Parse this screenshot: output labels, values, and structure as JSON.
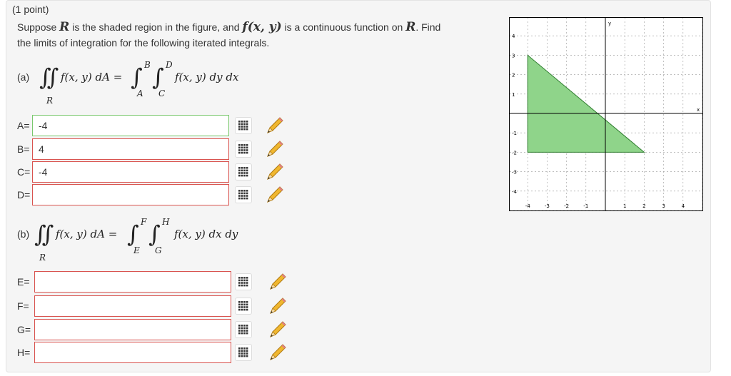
{
  "header": {
    "points": "(1 point)"
  },
  "problem": {
    "t1": "Suppose ",
    "R": "R",
    "t2": " is the shaded region in the figure, and ",
    "f": "f(x, y)",
    "t3": " is a continuous function on ",
    "R2": "R",
    "t4": ". Find",
    "line2": "the limits of integration for the following iterated integrals."
  },
  "part_a": {
    "label": "(a)",
    "int_sym": "∬",
    "region": "R",
    "integrand": "f(x, y) dA =",
    "single_int": "∫",
    "B": "B",
    "A": "A",
    "D": "D",
    "C": "C",
    "tail": "f(x, y) dy dx",
    "fields": [
      {
        "label": "A=",
        "value": "-4",
        "status": "correct"
      },
      {
        "label": "B=",
        "value": "4",
        "status": "incorrect"
      },
      {
        "label": "C=",
        "value": "-4",
        "status": "incorrect"
      },
      {
        "label": "D=",
        "value": "",
        "status": "incorrect"
      }
    ]
  },
  "part_b": {
    "label": "(b)",
    "int_sym": "∬",
    "region": "R",
    "integrand": "f(x, y) dA =",
    "single_int": "∫",
    "F": "F",
    "E": "E",
    "H": "H",
    "G": "G",
    "tail": "f(x, y) dx dy",
    "fields": [
      {
        "label": "E=",
        "value": "",
        "status": "incorrect"
      },
      {
        "label": "F=",
        "value": "",
        "status": "incorrect"
      },
      {
        "label": "G=",
        "value": "",
        "status": "incorrect"
      },
      {
        "label": "H=",
        "value": "",
        "status": "incorrect"
      }
    ]
  },
  "icons": {
    "math": "grid-icon",
    "preview": "pencil-icon"
  },
  "colors": {
    "correct_border": "#79c86d",
    "incorrect_border": "#d9534f",
    "region_fill": "#8fd48a",
    "region_stroke": "#2f7d2f"
  },
  "figure": {
    "x_axis_label": "x",
    "y_axis_label": "y",
    "xticks": [
      "-4",
      "-3",
      "-2",
      "-1",
      "1",
      "2",
      "3",
      "4"
    ],
    "yticks": [
      "4",
      "3",
      "2",
      "1",
      "-1",
      "-2",
      "-3",
      "-4"
    ],
    "region_vertices": [
      [
        -4,
        3
      ],
      [
        -4,
        -2
      ],
      [
        2,
        -2
      ]
    ]
  }
}
